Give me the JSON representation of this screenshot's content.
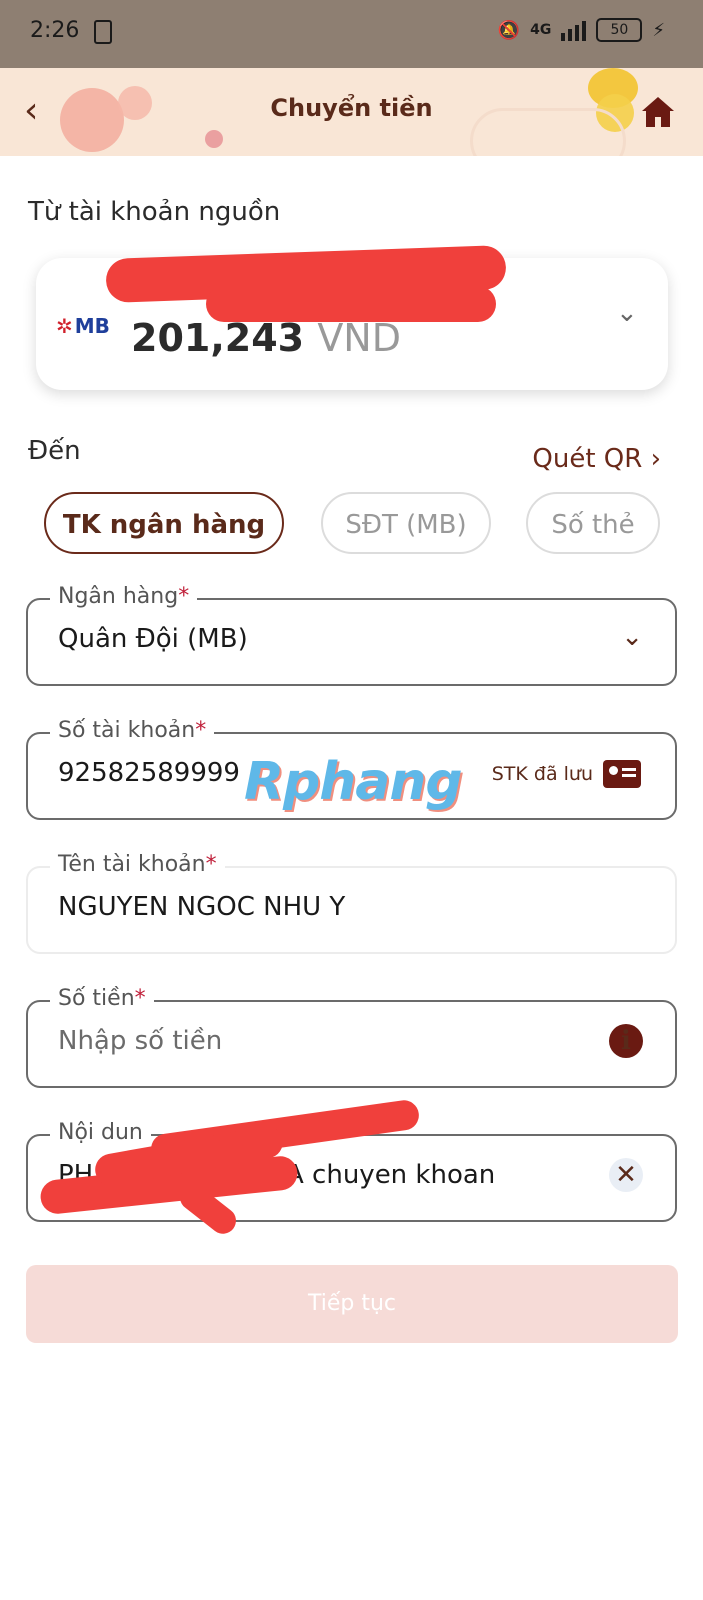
{
  "status_bar": {
    "time": "2:26",
    "network": "4G",
    "battery": "50"
  },
  "header": {
    "title": "Chuyển tiền"
  },
  "source": {
    "section_label": "Từ tài khoản nguồn",
    "bank_logo": "MB",
    "balance": "201,243",
    "currency": "VND"
  },
  "destination": {
    "label": "Đến",
    "qr_link": "Quét QR",
    "tabs": [
      {
        "label": "TK ngân hàng",
        "active": true
      },
      {
        "label": "SĐT (MB)",
        "active": false
      },
      {
        "label": "Số thẻ",
        "active": false
      }
    ]
  },
  "form": {
    "bank": {
      "label": "Ngân hàng",
      "required": "*",
      "value": "Quân Đội (MB)"
    },
    "account_number": {
      "label": "Số tài khoản",
      "required": "*",
      "value": "92582589999",
      "saved_link": "STK đã lưu"
    },
    "account_name": {
      "label": "Tên tài khoản",
      "required": "*",
      "value": "NGUYEN NGOC NHU Y"
    },
    "amount": {
      "label": "Số tiền",
      "required": "*",
      "placeholder": "Nhập số tiền"
    },
    "content": {
      "label": "Nội dun",
      "value_start": "PH",
      "value_end": "A chuyen khoan"
    }
  },
  "watermark": "Rphang",
  "continue_button": "Tiếp tục",
  "colors": {
    "brand": "#5a2a1a",
    "header_bg": "#f9e6d6",
    "redaction": "#f0403c",
    "button_disabled": "#f6dbd7"
  }
}
